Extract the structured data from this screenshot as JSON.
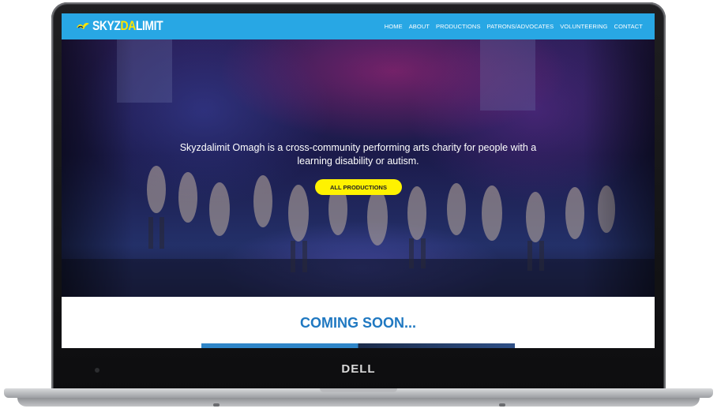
{
  "site": {
    "logo": {
      "part1": "SKYZ",
      "part2": "DA",
      "part3": "LIMIT"
    },
    "nav": [
      "HOME",
      "ABOUT",
      "PRODUCTIONS",
      "PATRONS/ADVOCATES",
      "VOLUNTEERING",
      "CONTACT"
    ]
  },
  "hero": {
    "tagline": "Skyzdalimit Omagh is a cross-community performing arts charity for people with a learning disability or autism.",
    "button_label": "ALL PRODUCTIONS"
  },
  "section": {
    "heading": "COMING SOON..."
  },
  "device": {
    "brand": "DELL"
  },
  "colors": {
    "navbar": "#28a7e4",
    "accent_yellow": "#fff200",
    "heading_blue": "#1f78c1"
  }
}
